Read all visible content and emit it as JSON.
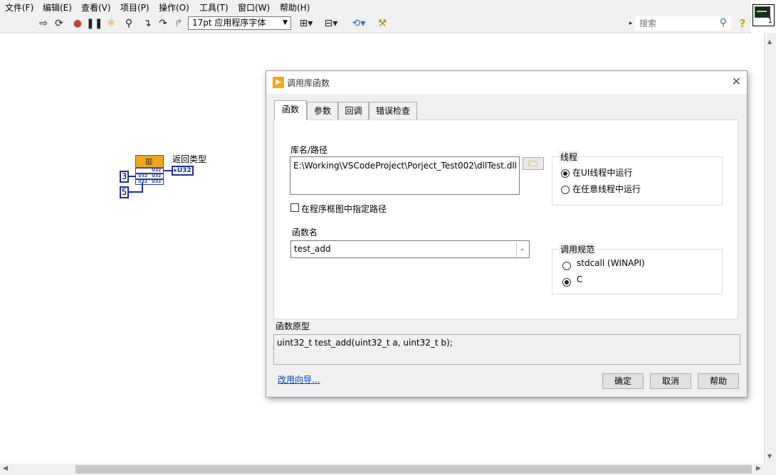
{
  "menu": [
    "文件(F)",
    "编辑(E)",
    "查看(V)",
    "项目(P)",
    "操作(O)",
    "工具(T)",
    "窗口(W)",
    "帮助(H)"
  ],
  "toolbar": {
    "font": "17pt 应用程序字体",
    "search_placeholder": "搜索",
    "icons": [
      "run-arrow-icon",
      "run-continuous-icon",
      "abort-icon",
      "pause-icon",
      "highlight-execution-icon",
      "retain-wire-values-icon",
      "step-into-icon",
      "step-over-icon",
      "step-out-icon",
      "align-icon",
      "distribute-icon",
      "reorder-icon",
      "cleanup-diagram-icon"
    ]
  },
  "vi_icon": {
    "number": "1"
  },
  "diagram": {
    "const_a": "3",
    "const_b": "5",
    "return_label": "返回类型",
    "indicator": "U32",
    "terminal_type": "U32"
  },
  "dialog": {
    "title": "调用库函数",
    "tabs": [
      "函数",
      "参数",
      "回调",
      "错误检查"
    ],
    "active_tab": "函数",
    "library_label": "库名/路径",
    "library_path": "E:\\Working\\VSCodeProject\\Porject_Test002\\dllTest.dll",
    "specify_path_label": "在程序框图中指定路径",
    "specify_path_checked": false,
    "function_name_label": "函数名",
    "function_name": "test_add",
    "thread_group": {
      "title": "线程",
      "options": [
        "在UI线程中运行",
        "在任意线程中运行"
      ],
      "selected": 0
    },
    "calling_group": {
      "title": "调用规范",
      "options": [
        "stdcall (WINAPI)",
        "C"
      ],
      "selected": 1
    },
    "prototype_label": "函数原型",
    "prototype": "uint32_t test_add(uint32_t a, uint32_t b);",
    "wizard_link": "改用向导...",
    "buttons": {
      "ok": "确定",
      "cancel": "取消",
      "help": "帮助"
    }
  }
}
